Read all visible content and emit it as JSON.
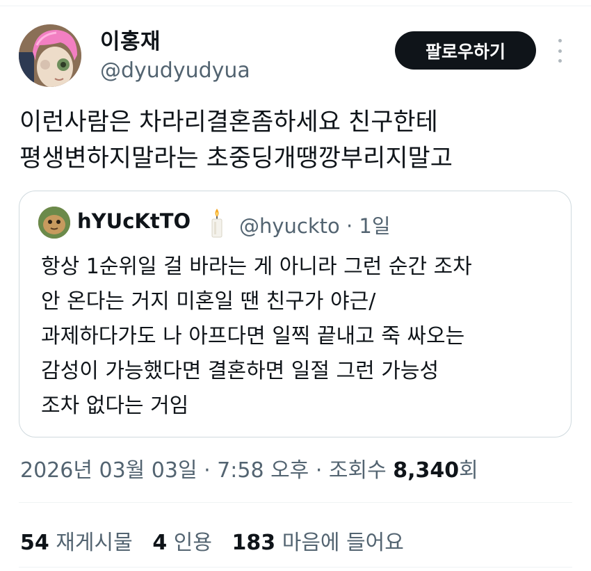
{
  "author": {
    "name": "이홍재",
    "handle": "@dyudyudyua",
    "avatar_icon": "avatar-pink-hair-doll"
  },
  "follow_label": "팔로우하기",
  "more_icon": "more-vertical-icon",
  "tweet": {
    "lines": [
      "이런사람은 차라리결혼좀하세요 친구한테",
      "평생변하지말라는 초중딩개땡깡부리지말고"
    ]
  },
  "quote": {
    "name": "hYUcKtTO",
    "emoji_icon": "candle-icon",
    "handle_time": "@hyuckto · 1일",
    "lines": [
      "항상 1순위일 걸 바라는 게 아니라 그런 순간 조차",
      "안 온다는 거지 미혼일 땐 친구가 야근/",
      "과제하다가도 나 아프다면 일찍 끝내고 죽 싸오는",
      "감성이 가능했다면 결혼하면 일절 그런 가능성",
      "조차 없다는 거임"
    ]
  },
  "meta": {
    "datetime": "2026년 03월 03일 · 7:58 오후 · 조회수 ",
    "views": "8,340",
    "views_suffix": "회"
  },
  "stats": {
    "retweets_count": "54",
    "retweets_label": "재게시물",
    "quotes_count": "4",
    "quotes_label": "인용",
    "likes_count": "183",
    "likes_label": "마음에 들어요"
  }
}
